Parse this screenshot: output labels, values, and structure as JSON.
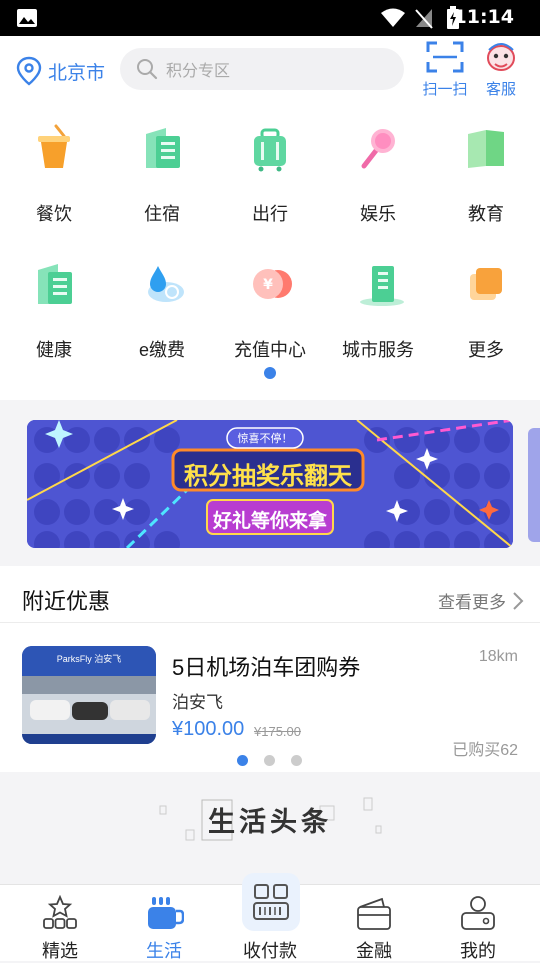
{
  "status_bar": {
    "time": "11:14"
  },
  "header": {
    "city": "北京市",
    "search_placeholder": "积分专区",
    "scan_label": "扫一扫",
    "service_label": "客服"
  },
  "categories": [
    {
      "label": "餐饮",
      "icon": "drink-cup-icon"
    },
    {
      "label": "住宿",
      "icon": "building-icon"
    },
    {
      "label": "出行",
      "icon": "luggage-icon"
    },
    {
      "label": "娱乐",
      "icon": "microphone-icon"
    },
    {
      "label": "教育",
      "icon": "book-icon"
    },
    {
      "label": "健康",
      "icon": "health-building-icon"
    },
    {
      "label": "e缴费",
      "icon": "water-drop-cloud-icon"
    },
    {
      "label": "充值中心",
      "icon": "yuan-coin-icon"
    },
    {
      "label": "城市服务",
      "icon": "city-building-icon"
    },
    {
      "label": "更多",
      "icon": "more-squares-icon"
    }
  ],
  "banner": {
    "badge": "惊喜不停！",
    "title": "积分抽奖乐翻天",
    "subtitle": "好礼等你来拿"
  },
  "nearby": {
    "title": "附近优惠",
    "more_label": "查看更多",
    "deal": {
      "image_logo": "ParksFly 泊安飞",
      "title": "5日机场泊车团购券",
      "shop": "泊安飞",
      "price": "¥100.00",
      "original_price": "¥175.00",
      "distance": "18km",
      "sold": "已购买62"
    }
  },
  "headline": {
    "title": "生活头条"
  },
  "bottom_nav": [
    {
      "label": "精选",
      "icon": "star-blocks-icon",
      "active": false
    },
    {
      "label": "生活",
      "icon": "coffee-cup-icon",
      "active": true
    },
    {
      "label": "收付款",
      "icon": "qr-barcode-icon",
      "active": false
    },
    {
      "label": "金融",
      "icon": "wallet-icon",
      "active": false
    },
    {
      "label": "我的",
      "icon": "user-card-icon",
      "active": false
    }
  ],
  "colors": {
    "accent": "#3b82e8",
    "price": "#3b82e8"
  }
}
